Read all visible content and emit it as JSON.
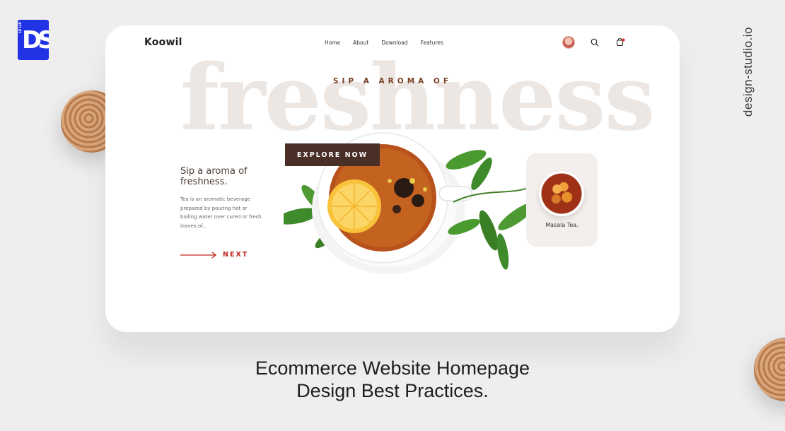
{
  "branding": {
    "badge_small_text": "UI UX",
    "badge_letters": "DS",
    "site_url": "design-studio.io"
  },
  "card": {
    "brand": "Koowil",
    "nav": {
      "items": [
        "Home",
        "About",
        "Download",
        "Features"
      ]
    },
    "header_icons": [
      "avatar",
      "search-icon",
      "cart-icon"
    ],
    "hero": {
      "background_word": "freshness",
      "tagline": "SIP A AROMA OF",
      "explore_button": "EXPLORE NOW",
      "title": "Sip a aroma of freshness.",
      "description": "Tea is an aromatic beverage prepared by pouring hot or boiling water over cured or fresh leaves of...",
      "next_label": "NEXT"
    },
    "product": {
      "name": "Masala Tea."
    }
  },
  "caption": {
    "line1": "Ecommerce Website Homepage",
    "line2": "Design Best Practices."
  },
  "colors": {
    "badge_blue": "#2233e6",
    "button_brown": "#4a2f27",
    "accent_red": "#c0261e",
    "tagline_brown": "#7a3e24"
  }
}
